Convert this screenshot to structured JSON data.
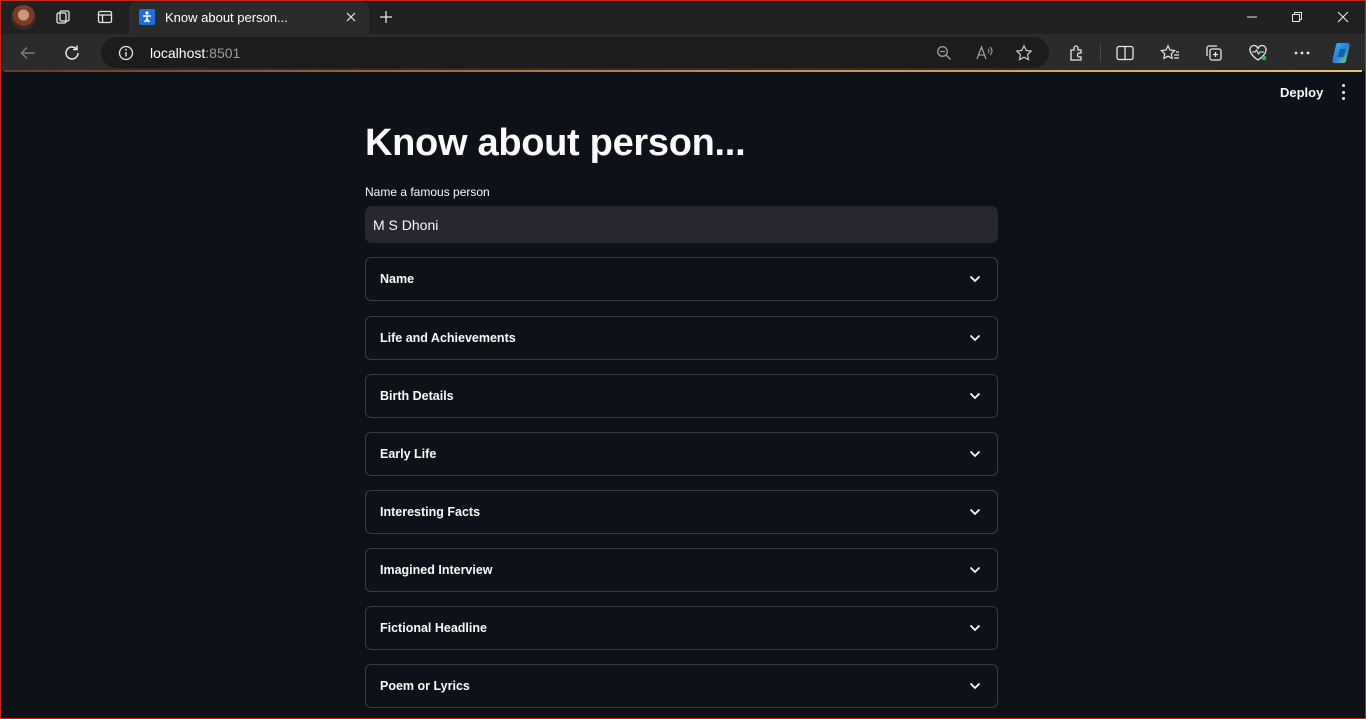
{
  "browser": {
    "tab_title": "Know about person...",
    "url_host": "localhost",
    "url_port": ":8501",
    "icons": [
      "profile-avatar",
      "workspaces-icon",
      "tab-actions-icon",
      "info-icon",
      "zoom-out-icon",
      "read-aloud-icon",
      "favorite-star-icon",
      "extensions-icon",
      "split-screen-icon",
      "favorites-icon",
      "collections-icon",
      "browser-essentials-icon",
      "more-icon",
      "copilot-icon"
    ]
  },
  "app": {
    "deploy_label": "Deploy",
    "title": "Know about person...",
    "input": {
      "label": "Name a famous person",
      "value": "M S Dhoni"
    },
    "expanders": [
      {
        "label": "Name"
      },
      {
        "label": "Life and Achievements"
      },
      {
        "label": "Birth Details"
      },
      {
        "label": "Early Life"
      },
      {
        "label": "Interesting Facts"
      },
      {
        "label": "Imagined Interview"
      },
      {
        "label": "Fictional Headline"
      },
      {
        "label": "Poem or Lyrics"
      }
    ]
  },
  "colors": {
    "app_bg": "#0e1117",
    "input_bg": "#262730",
    "border": "#3a3c45",
    "window_border": "#c42b1c"
  }
}
